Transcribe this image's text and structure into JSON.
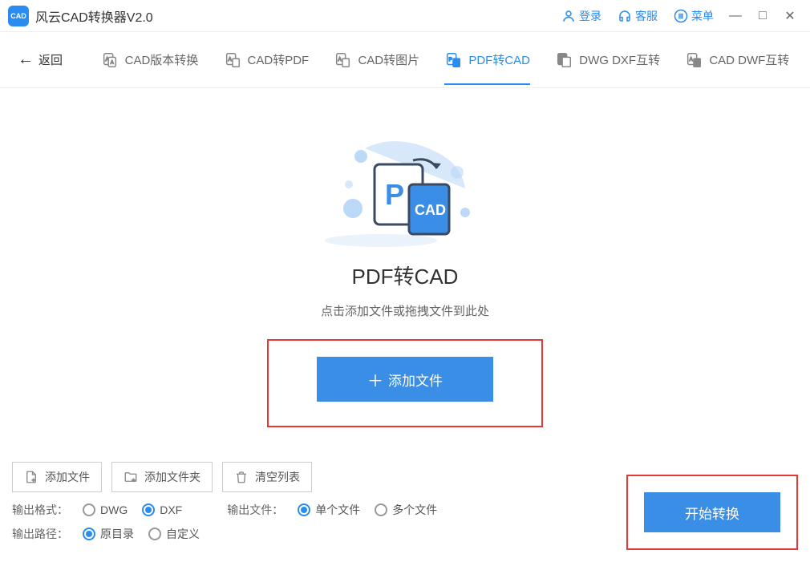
{
  "titlebar": {
    "app_title": "风云CAD转换器V2.0",
    "login": "登录",
    "support": "客服",
    "menu": "菜单"
  },
  "back_label": "返回",
  "tabs": [
    {
      "label": "CAD版本转换"
    },
    {
      "label": "CAD转PDF"
    },
    {
      "label": "CAD转图片"
    },
    {
      "label": "PDF转CAD"
    },
    {
      "label": "DWG DXF互转"
    },
    {
      "label": "CAD DWF互转"
    }
  ],
  "main": {
    "title": "PDF转CAD",
    "subtitle": "点击添加文件或拖拽文件到此处",
    "add_button": "添加文件"
  },
  "bottom": {
    "add_file": "添加文件",
    "add_folder": "添加文件夹",
    "clear_list": "清空列表",
    "output_format_label": "输出格式：",
    "format_dwg": "DWG",
    "format_dxf": "DXF",
    "output_file_label": "输出文件：",
    "file_single": "单个文件",
    "file_multi": "多个文件",
    "output_path_label": "输出路径：",
    "path_original": "原目录",
    "path_custom": "自定义",
    "start_button": "开始转换"
  }
}
